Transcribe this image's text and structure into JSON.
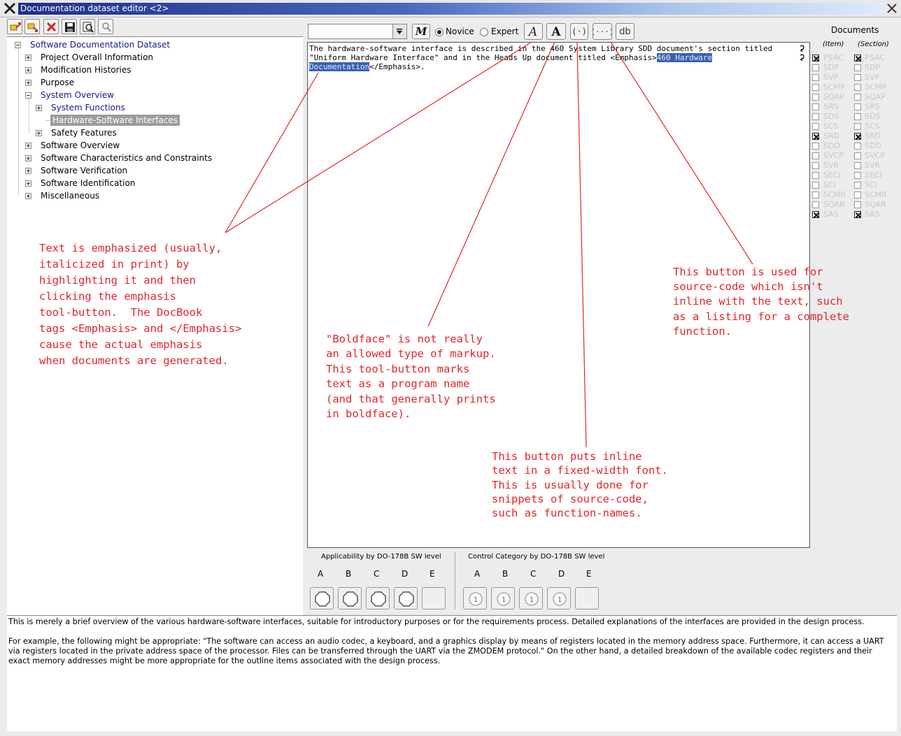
{
  "window": {
    "title": "Documentation dataset editor <2>"
  },
  "toolbar": {
    "icons": [
      "add-sibling-icon",
      "add-child-icon",
      "delete-icon",
      "save-icon",
      "preview-icon",
      "search-icon"
    ]
  },
  "tree": {
    "root": "Software Documentation Dataset",
    "items": [
      {
        "label": "Project Overall Information",
        "expanded": false
      },
      {
        "label": "Modification Histories",
        "expanded": false
      },
      {
        "label": "Purpose",
        "expanded": false
      },
      {
        "label": "System Overview",
        "expanded": true,
        "children": [
          {
            "label": "System Functions",
            "expanded": false
          },
          {
            "label": "Hardware-Software Interfaces",
            "selected": true
          },
          {
            "label": "Safety Features",
            "expanded": false
          }
        ]
      },
      {
        "label": "Software Overview",
        "expanded": false
      },
      {
        "label": "Software Characteristics and Constraints",
        "expanded": false
      },
      {
        "label": "Software Verification",
        "expanded": false
      },
      {
        "label": "Software Identification",
        "expanded": false
      },
      {
        "label": "Miscellaneous",
        "expanded": false
      }
    ]
  },
  "editor_toolbar": {
    "combo_value": "",
    "mode_novice": "Novice",
    "mode_expert": "Expert",
    "selected_mode": "Novice",
    "db_label": "db"
  },
  "editor": {
    "line1": "The hardware-software interface is described in the 460 System Library SDD document's section titled",
    "line2_plain": "\"Uniform Hardware Interface\" and in the Heads Up document titled <Emphasis>",
    "line2_hl": "460 Hardware",
    "line3_hl": "Documentation",
    "line3_plain": "</Emphasis>."
  },
  "documents": {
    "heading": "Documents",
    "item_label": "(Item)",
    "section_label": "(Section)",
    "list": [
      {
        "name": "PSAC",
        "item": true,
        "section": true
      },
      {
        "name": "SDP",
        "item": false,
        "section": false
      },
      {
        "name": "SVP",
        "item": false,
        "section": false
      },
      {
        "name": "SCMP",
        "item": false,
        "section": false
      },
      {
        "name": "SQAP",
        "item": false,
        "section": false
      },
      {
        "name": "SRS",
        "item": false,
        "section": false
      },
      {
        "name": "SDS",
        "item": false,
        "section": false
      },
      {
        "name": "SCS",
        "item": false,
        "section": false
      },
      {
        "name": "SRD",
        "item": true,
        "section": true
      },
      {
        "name": "SDD",
        "item": false,
        "section": false
      },
      {
        "name": "SVCP",
        "item": false,
        "section": false
      },
      {
        "name": "SVR",
        "item": false,
        "section": false
      },
      {
        "name": "SECI",
        "item": false,
        "section": false
      },
      {
        "name": "SCI",
        "item": false,
        "section": false
      },
      {
        "name": "SCMR",
        "item": false,
        "section": false
      },
      {
        "name": "SQAR",
        "item": false,
        "section": false
      },
      {
        "name": "SAS",
        "item": true,
        "section": true
      }
    ]
  },
  "applicability": {
    "label": "Applicability by DO-178B SW level",
    "levels": [
      "A",
      "B",
      "C",
      "D",
      "E"
    ]
  },
  "control_category": {
    "label": "Control Category by DO-178B SW level",
    "levels": [
      "A",
      "B",
      "C",
      "D",
      "E"
    ]
  },
  "description": {
    "para1": "This is merely a brief overview of the various hardware-software interfaces, suitable for introductory purposes or for the requirements process.  Detailed explanations of the interfaces are provided in the design process.",
    "para2": "For example, the following might be appropriate:  \"The software can access an audio codec, a keyboard, and a graphics display by means of registers located in the memory address space.  Furthermore, it can access a UART via registers located in the private address space of the processor.  Files can be transferred through the UART via the ZMODEM protocol.\"  On the other hand, a detailed breakdown of the available codec registers and their exact memory addresses might be more appropriate for the outline items associated with the design process."
  },
  "annotations": {
    "emphasis": "Text is emphasized (usually,\nitalicized in print) by\nhighlighting it and then\nclicking the emphasis\ntool-button.  The DocBook\ntags <Emphasis> and </Emphasis>\ncause the actual emphasis\nwhen documents are generated.",
    "boldface": "\"Boldface\" is not really\nan allowed type of markup.\nThis tool-button marks\ntext as a program name\n(and that generally prints\nin boldface).",
    "inline": "This button puts inline\ntext in a fixed-width font.\nThis is usually done for\nsnippets of source-code,\nsuch as function-names.",
    "listing": "This button is used for\nsource-code which isn't\ninline with the text, such\nas a listing for a complete\nfunction."
  },
  "colors": {
    "annotation": "#e4252a",
    "selection": "#3a62b4",
    "title_gradient_start": "#1f2f8a"
  }
}
